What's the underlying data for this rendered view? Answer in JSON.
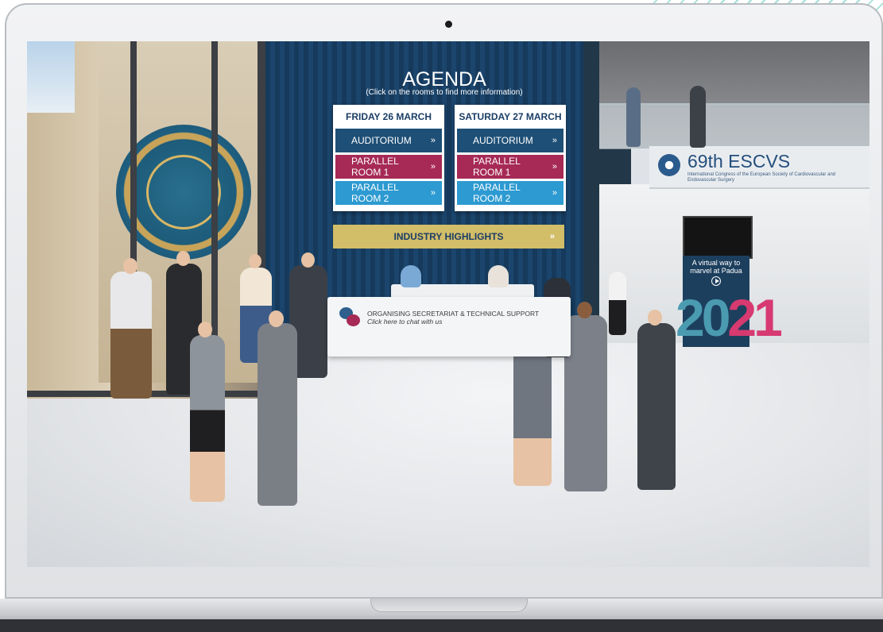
{
  "agenda": {
    "title": "AGENDA",
    "hint": "(Click on the rooms to find more information)",
    "days": [
      {
        "label": "FRIDAY 26 MARCH",
        "rooms": [
          {
            "label": "AUDITORIUM",
            "chevron": "»"
          },
          {
            "label": "PARALLEL ROOM 1",
            "chevron": "»"
          },
          {
            "label": "PARALLEL ROOM 2",
            "chevron": "»"
          }
        ]
      },
      {
        "label": "SATURDAY 27 MARCH",
        "rooms": [
          {
            "label": "AUDITORIUM",
            "chevron": "»"
          },
          {
            "label": "PARALLEL ROOM 1",
            "chevron": "»"
          },
          {
            "label": "PARALLEL ROOM 2",
            "chevron": "»"
          }
        ]
      }
    ],
    "industry": {
      "label": "INDUSTRY HIGHLIGHTS",
      "chevron": "»"
    }
  },
  "support": {
    "title": "ORGANISING SECRETARIAT & TECHNICAL SUPPORT",
    "link": "Click here to chat with us"
  },
  "banner": {
    "title": "69th ESCVS",
    "subtitle": "International Congress of the European Society of Cardiovascular and Endovascular Surgery"
  },
  "promo": {
    "text": "A virtual way to marvel at Padua",
    "year_a": "20",
    "year_b": "21"
  },
  "colors": {
    "navy": "#1e4f76",
    "magenta": "#a62a55",
    "sky": "#2d9ad1",
    "gold": "#d2bd68",
    "heading": "#1b3d66"
  }
}
